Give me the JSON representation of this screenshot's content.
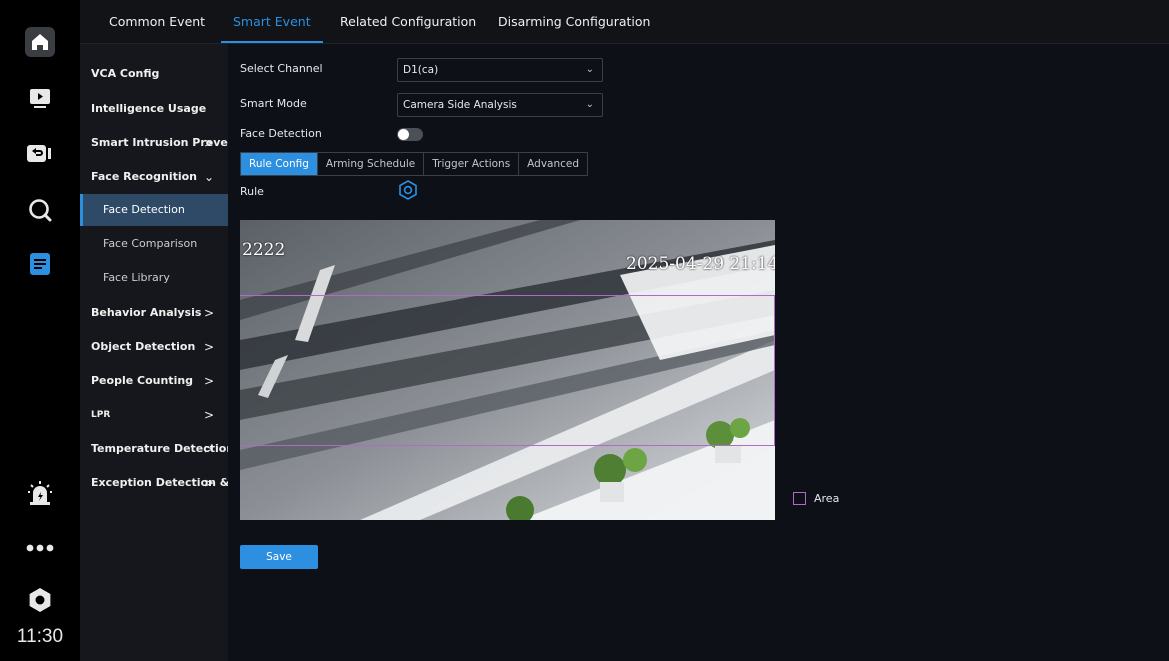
{
  "clock": "11:30",
  "top_tabs": [
    "Common Event",
    "Smart Event",
    "Related Configuration",
    "Disarming Configuration"
  ],
  "menu": {
    "vca_config": "VCA Config",
    "intelligence_usage": "Intelligence Usage",
    "smart_intrusion": "Smart Intrusion Preve...",
    "face_recognition": "Face Recognition",
    "face_detection": "Face Detection",
    "face_comparison": "Face Comparison",
    "face_library": "Face Library",
    "behavior_analysis": "Behavior Analysis",
    "object_detection": "Object Detection",
    "people_counting": "People Counting",
    "lpr": "LPR",
    "temperature_detection": "Temperature Detection",
    "exception_detection": "Exception Detection &..."
  },
  "form": {
    "select_channel_label": "Select Channel",
    "select_channel_value": "D1(ca)",
    "smart_mode_label": "Smart Mode",
    "smart_mode_value": "Camera Side Analysis",
    "face_detection_label": "Face Detection",
    "face_detection_enabled": false,
    "rule_label": "Rule"
  },
  "sub_tabs": [
    "Rule Config",
    "Arming Schedule",
    "Trigger Actions",
    "Advanced"
  ],
  "video": {
    "osd_name": "2222",
    "osd_timestamp": "2025-04-29 21:14"
  },
  "area_label": "Area",
  "save_label": "Save",
  "colors": {
    "accent": "#2d8fe0",
    "rule_line": "#b06bc8",
    "rail_bg": "#000000",
    "menu_bg": "#15171c"
  },
  "icons": [
    "home-icon",
    "playback-icon",
    "backup-icon",
    "search-icon",
    "document-icon",
    "alarm-icon",
    "more-icon",
    "settings-icon",
    "hexagon-settings-icon"
  ]
}
